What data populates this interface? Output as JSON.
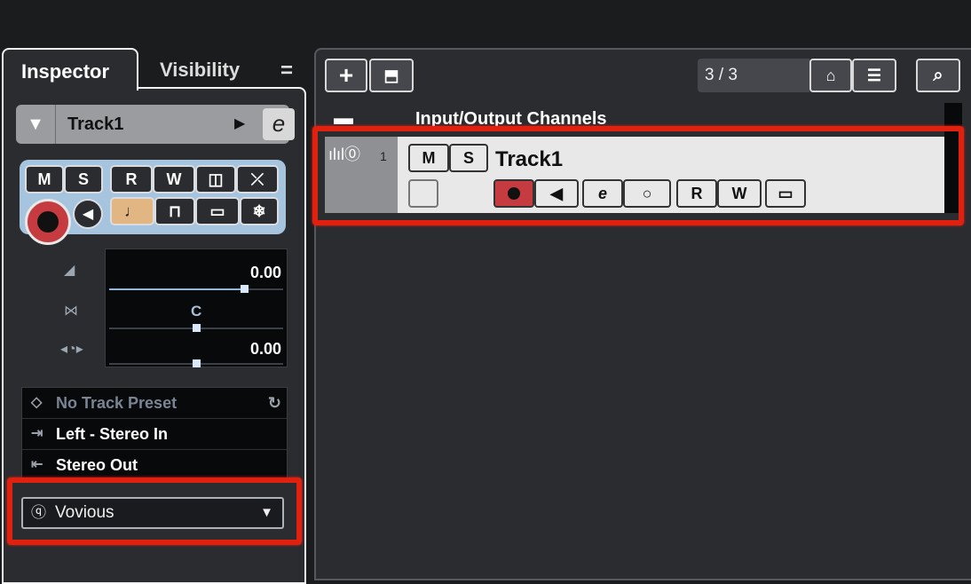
{
  "inspector": {
    "tab_inspector": "Inspector",
    "tab_visibility": "Visibility",
    "menu_icon": "hamburger-icon",
    "track_name": "Track1",
    "buttons": {
      "mute": "M",
      "solo": "S",
      "read": "R",
      "write": "W"
    },
    "volume": "0.00",
    "pan": "C",
    "delay": "0.00",
    "preset": "No Track Preset",
    "input": "Left - Stereo In",
    "output": "Stereo Out",
    "voice_dropdown": "Vovious"
  },
  "project": {
    "counter": "3 / 3",
    "folder_name": "Input/Output Channels",
    "track": {
      "number": "1",
      "name": "Track1",
      "mute": "M",
      "solo": "S",
      "read": "R",
      "write": "W"
    }
  },
  "colors": {
    "record": "#c63b3f",
    "highlight_outline": "#e0210f",
    "inspector_panel": "#a6c4dd"
  }
}
